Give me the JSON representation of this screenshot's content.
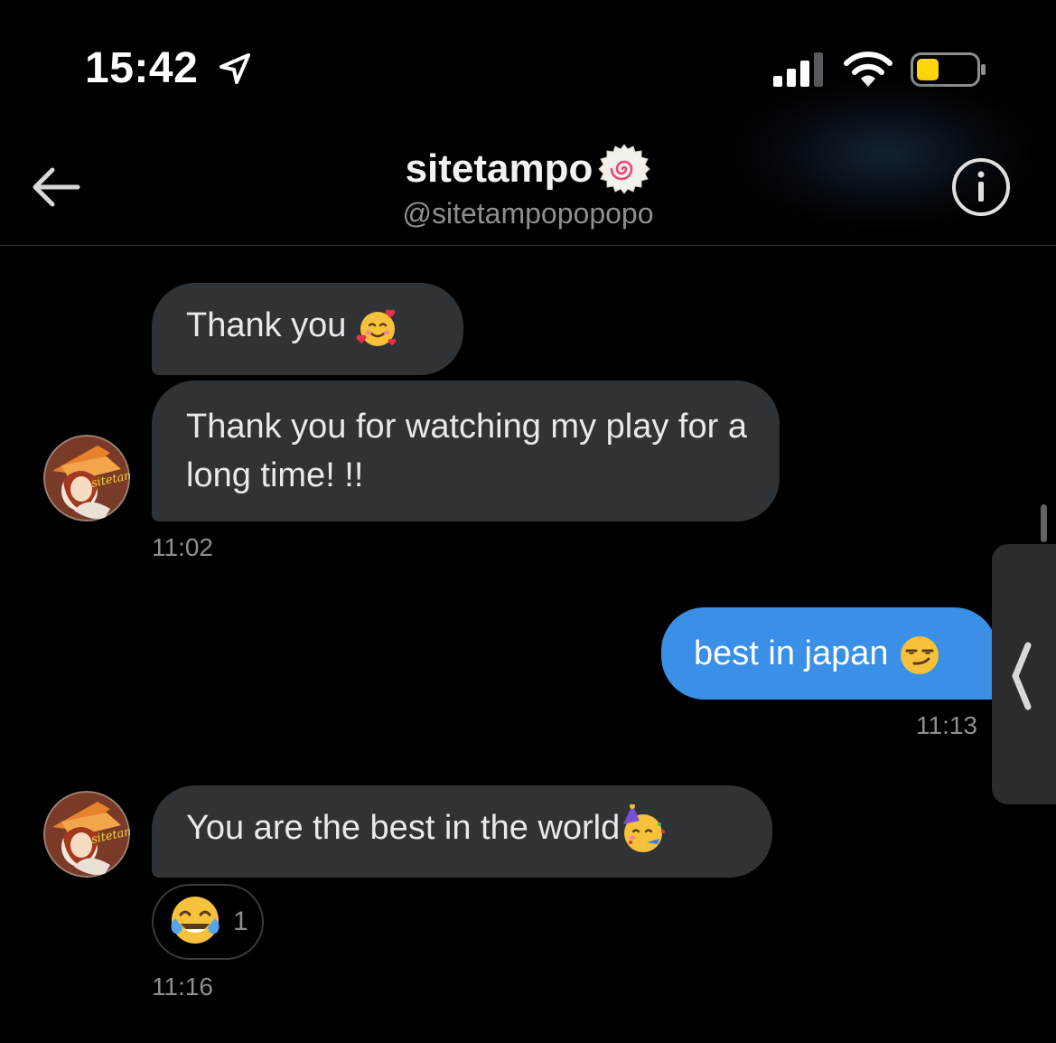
{
  "status_bar": {
    "time": "15:42",
    "battery_color": "#ffd60a"
  },
  "header": {
    "display_name": "sitetampo",
    "handle": "@sitetampopopopo",
    "name_badge_icon": "narutomaki-icon",
    "back_icon": "arrow-left-icon",
    "info_icon": "info-icon"
  },
  "messages": [
    {
      "sender": "sitetampo",
      "text": "Thank you ",
      "emoji": "smiling-face-with-hearts"
    },
    {
      "sender": "sitetampo",
      "text": "Thank you for watching my play for a long time! !!",
      "timestamp": "11:02"
    },
    {
      "sender": "me",
      "text": "best in japan ",
      "emoji": "smirking-face",
      "timestamp": "11:13"
    },
    {
      "sender": "sitetampo",
      "text": "You are the best in the world",
      "emoji": "partying-face",
      "reaction": {
        "emoji": "face-with-tears-of-joy",
        "count": "1"
      },
      "timestamp": "11:16"
    }
  ],
  "colors": {
    "incoming_bubble": "#2f3336",
    "outgoing_bubble": "#3a8fe6",
    "background": "#000000"
  }
}
